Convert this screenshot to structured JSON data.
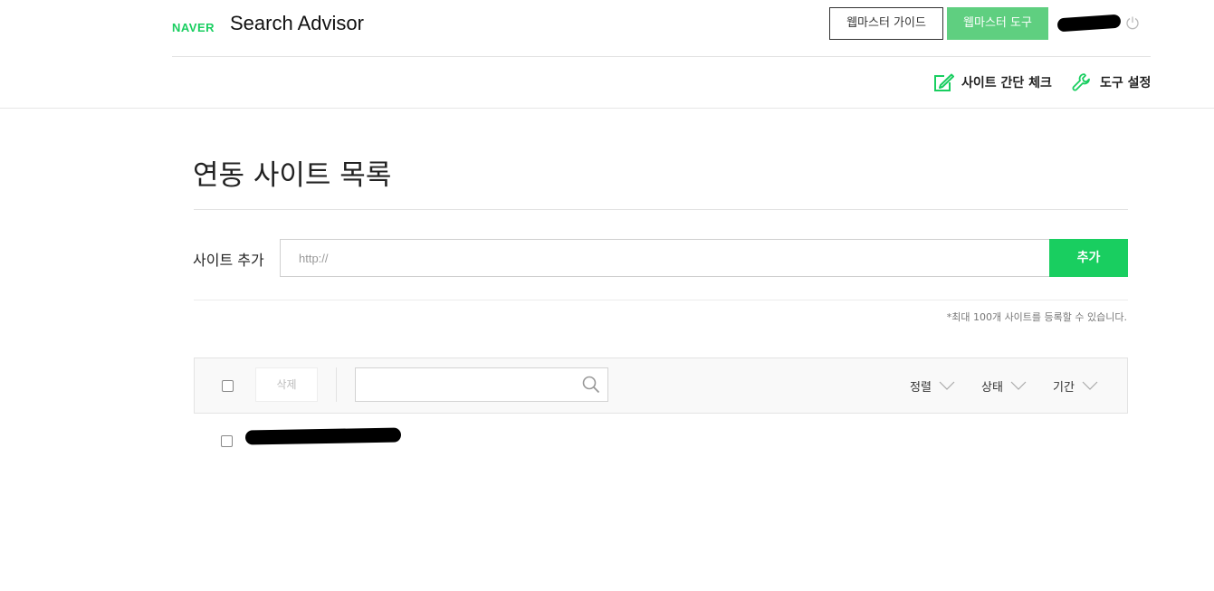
{
  "header": {
    "brand": "NAVER",
    "title": "Search Advisor",
    "guide_button": "웹마스터 가이드",
    "tool_button": "웹마스터 도구"
  },
  "subnav": {
    "site_check": "사이트 간단 체크",
    "tool_settings": "도구 설정"
  },
  "page": {
    "title": "연동 사이트 목록"
  },
  "add_site": {
    "label": "사이트 추가",
    "placeholder": "http://",
    "value": "",
    "button": "추가",
    "note": "*최대 100개 사이트를 등록할 수 있습니다."
  },
  "list_toolbar": {
    "delete_button": "삭제",
    "search_value": "",
    "sort_options": [
      "정렬",
      "상태",
      "기간"
    ]
  },
  "sites": [
    {
      "url": "",
      "checked": false
    }
  ],
  "colors": {
    "brand_green": "#19ce60",
    "tool_button_green": "#5fcf80"
  }
}
